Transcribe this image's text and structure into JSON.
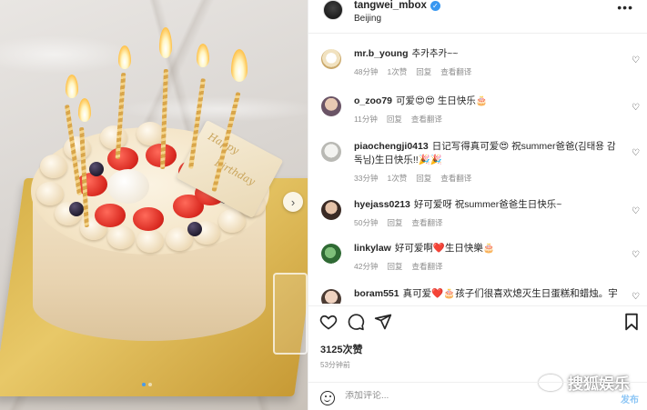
{
  "post": {
    "username": "tangwei_mbox",
    "location": "Beijing",
    "more_glyph": "•••",
    "card_text_1": "Happy",
    "card_text_2": "Birthday"
  },
  "comments": [
    {
      "user": "mr.b_young",
      "text": "추카추카~~",
      "time": "48分钟",
      "likes": "1次赞",
      "reply": "回复",
      "translate": "查看翻译"
    },
    {
      "user": "o_zoo79",
      "text": "可爱😍😍 生日快乐🎂",
      "time": "11分钟",
      "reply": "回复",
      "translate": "查看翻译"
    },
    {
      "user": "piaochengji0413",
      "text": "日记写得真可爱😍 祝summer爸爸(김태용 감독님)生日快乐!!🎉🎉",
      "time": "33分钟",
      "likes": "1次赞",
      "reply": "回复",
      "translate": "查看翻译"
    },
    {
      "user": "hyejass0213",
      "text": "好可爱呀 祝summer爸爸生日快乐~",
      "time": "50分钟",
      "reply": "回复",
      "translate": "查看翻译"
    },
    {
      "user": "linkylaw",
      "text": "好可爱啊❤️生日快樂🎂",
      "time": "42分钟",
      "reply": "回复",
      "translate": "查看翻译"
    },
    {
      "user": "boram551",
      "text": "真可爱❤️🎂孩子们很喜欢熄灭生日蛋糕和蜡烛。宇",
      "time": "",
      "reply": "",
      "translate": ""
    }
  ],
  "likes_count": "3125次赞",
  "posted_time": "53分钟前",
  "composer": {
    "placeholder": "添加评论...",
    "post_label": "发布"
  },
  "watermark": "搜狐娱乐",
  "icons": {
    "heart": "heart-icon",
    "comment": "comment-icon",
    "share": "share-icon",
    "bookmark": "bookmark-icon",
    "emoji": "emoji-icon",
    "next": "chevron-right-icon"
  },
  "colors": {
    "verified": "#3897f0",
    "post_button": "#8dc6f5",
    "muted": "#8e8e8e",
    "text": "#262626"
  }
}
